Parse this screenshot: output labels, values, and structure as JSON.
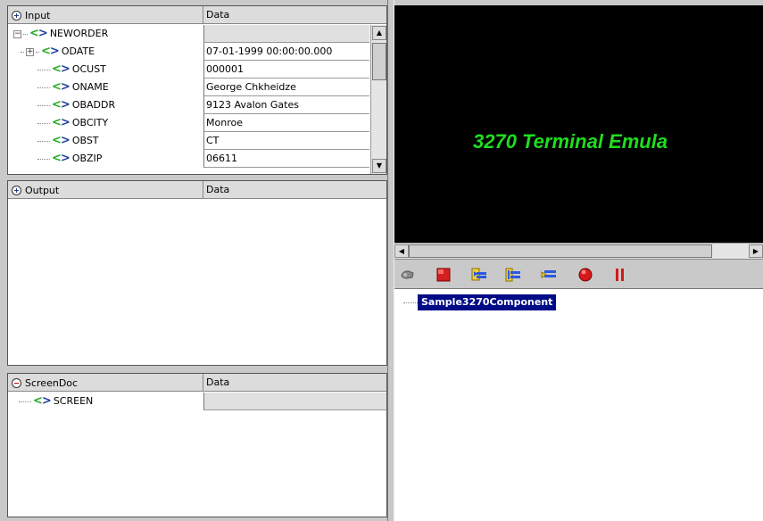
{
  "input_panel": {
    "col_name": "Input",
    "col_data": "Data",
    "root": "NEWORDER",
    "fields": [
      {
        "name": "ODATE",
        "value": "07-01-1999 00:00:00.000",
        "expandable": true
      },
      {
        "name": "OCUST",
        "value": "000001"
      },
      {
        "name": "ONAME",
        "value": "George Chkheidze"
      },
      {
        "name": "OBADDR",
        "value": "9123 Avalon Gates"
      },
      {
        "name": "OBCITY",
        "value": "Monroe"
      },
      {
        "name": "OBST",
        "value": "CT"
      },
      {
        "name": "OBZIP",
        "value": "06611"
      }
    ]
  },
  "output_panel": {
    "col_name": "Output",
    "col_data": "Data"
  },
  "screendoc_panel": {
    "col_name": "ScreenDoc",
    "col_data": "Data",
    "root": "SCREEN"
  },
  "terminal": {
    "title": "3270 Terminal Emula"
  },
  "toolbar": {
    "icons": [
      "connect-icon",
      "stop-icon",
      "record-screen-icon",
      "insert-screen-icon",
      "play-screen-icon",
      "record-icon",
      "pause-icon"
    ]
  },
  "component_tree": {
    "item": "Sample3270Component"
  },
  "colors": {
    "terminal_text": "#1fdd1f",
    "selection": "#000b86",
    "tag_open": "#22aa22",
    "tag_close": "#1f3f9f"
  }
}
